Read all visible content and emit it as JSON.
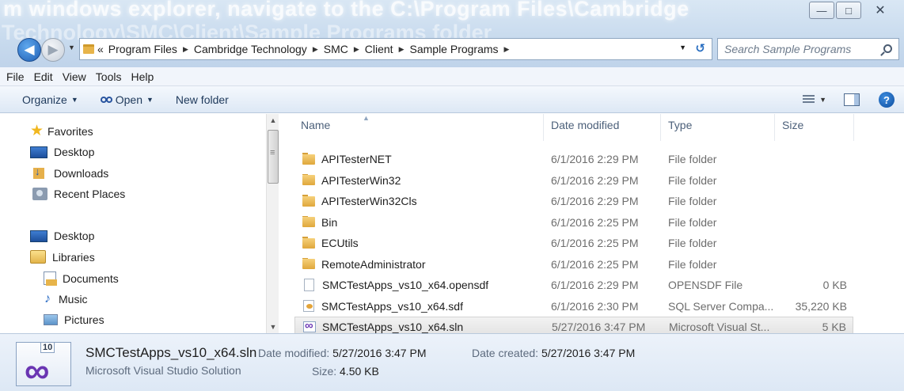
{
  "titlebar": {
    "overlay_text_line1": "m windows explorer, navigate to the C:\\Program Files\\Cambridge",
    "overlay_text_line2": "Technology\\SMC\\Client\\Sample Programs folder",
    "minimize_glyph": "—",
    "maximize_glyph": "□",
    "close_glyph": "✕"
  },
  "address": {
    "overflow": "«",
    "crumbs": [
      "Program Files",
      "Cambridge Technology",
      "SMC",
      "Client",
      "Sample Programs"
    ],
    "separator": "▶",
    "dropdown_glyph": "▼",
    "refresh_glyph": "↺"
  },
  "search": {
    "placeholder": "Search Sample Programs"
  },
  "menu": [
    "File",
    "Edit",
    "View",
    "Tools",
    "Help"
  ],
  "toolbar": {
    "organize": "Organize",
    "open": "Open",
    "new_folder": "New folder",
    "dropdown_glyph": "▼",
    "help_glyph": "?"
  },
  "nav": {
    "favorites": "Favorites",
    "fav_items": [
      "Desktop",
      "Downloads",
      "Recent Places"
    ],
    "desktop": "Desktop",
    "libraries": "Libraries",
    "lib_items": [
      "Documents",
      "Music",
      "Pictures"
    ],
    "scroll_up_glyph": "▲",
    "scroll_down_glyph": "▼"
  },
  "columns": {
    "name": "Name",
    "date": "Date modified",
    "type": "Type",
    "size": "Size",
    "sort_glyph": "▲"
  },
  "files": [
    {
      "name": "APITesterNET",
      "date": "6/1/2016 2:29 PM",
      "type": "File folder",
      "size": "",
      "icon": "folder-icon"
    },
    {
      "name": "APITesterWin32",
      "date": "6/1/2016 2:29 PM",
      "type": "File folder",
      "size": "",
      "icon": "folder-icon"
    },
    {
      "name": "APITesterWin32Cls",
      "date": "6/1/2016 2:29 PM",
      "type": "File folder",
      "size": "",
      "icon": "folder-icon"
    },
    {
      "name": "Bin",
      "date": "6/1/2016 2:25 PM",
      "type": "File folder",
      "size": "",
      "icon": "folder-icon"
    },
    {
      "name": "ECUtils",
      "date": "6/1/2016 2:25 PM",
      "type": "File folder",
      "size": "",
      "icon": "folder-icon"
    },
    {
      "name": "RemoteAdministrator",
      "date": "6/1/2016 2:25 PM",
      "type": "File folder",
      "size": "",
      "icon": "folder-icon"
    },
    {
      "name": "SMCTestApps_vs10_x64.opensdf",
      "date": "6/1/2016 2:29 PM",
      "type": "OPENSDF File",
      "size": "0 KB",
      "icon": "file-icon"
    },
    {
      "name": "SMCTestApps_vs10_x64.sdf",
      "date": "6/1/2016 2:30 PM",
      "type": "SQL Server Compa...",
      "size": "35,220 KB",
      "icon": "sdf-icon"
    },
    {
      "name": "SMCTestApps_vs10_x64.sln",
      "date": "5/27/2016 3:47 PM",
      "type": "Microsoft Visual St...",
      "size": "5 KB",
      "icon": "sln-icon",
      "selected": true
    }
  ],
  "details": {
    "badge": "10",
    "filename": "SMCTestApps_vs10_x64.sln",
    "filetype": "Microsoft Visual Studio Solution",
    "modified_label": "Date modified:",
    "modified_value": "5/27/2016 3:47 PM",
    "created_label": "Date created:",
    "created_value": "5/27/2016 3:47 PM",
    "size_label": "Size:",
    "size_value": "4.50 KB"
  },
  "colors": {
    "accent": "#1f5fb4",
    "folder": "#e7b44a",
    "chrome": "#c9dbee"
  }
}
